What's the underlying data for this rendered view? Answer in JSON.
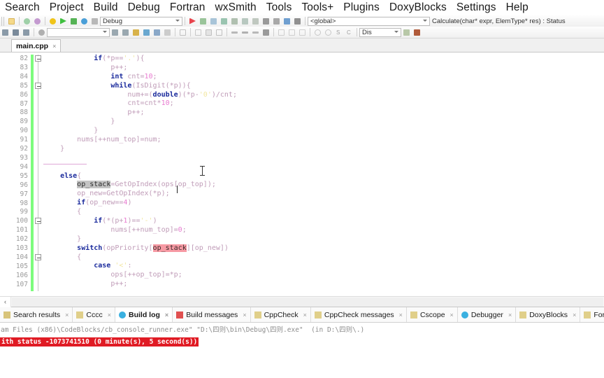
{
  "menubar": {
    "items": [
      {
        "label": "Search"
      },
      {
        "label": "Project"
      },
      {
        "label": "Build"
      },
      {
        "label": "Debug"
      },
      {
        "label": "Fortran"
      },
      {
        "label": "wxSmith"
      },
      {
        "label": "Tools"
      },
      {
        "label": "Tools+"
      },
      {
        "label": "Plugins"
      },
      {
        "label": "DoxyBlocks"
      },
      {
        "label": "Settings"
      },
      {
        "label": "Help"
      }
    ]
  },
  "toolbar": {
    "build_target": "Debug",
    "scope": "<global>",
    "function": "Calculate(char* expr, ElemType* res) : Status",
    "search_value": "",
    "dis_value": "Dis",
    "icons_row1": [
      "new-file-icon",
      "find-icon",
      "find-replace-icon",
      "build-icon",
      "run-icon",
      "build-and-run-icon",
      "rebuild-icon",
      "abort-icon"
    ],
    "icons_debug": [
      "debug-continue-icon",
      "debug-run-to-cursor-icon",
      "debug-next-line-icon",
      "debug-step-into-icon",
      "debug-step-out-icon",
      "debug-next-instruction-icon",
      "debug-step-into-instruction-icon",
      "debug-break-icon",
      "debug-stop-icon",
      "debug-info-icon",
      "debug-window-icon"
    ],
    "icons_row2": [
      "nav-back-icon",
      "nav-home-icon",
      "nav-forward-icon",
      "clear-icon",
      "goto-prev-icon",
      "goto-next-icon",
      "bookmark-icon",
      "translate-icon",
      "compare-icon",
      "more-icon"
    ]
  },
  "file_tabs": [
    {
      "label": "main.cpp",
      "close": "×",
      "active": true
    }
  ],
  "editor": {
    "first_line": 82,
    "code_lines": [
      {
        "n": 82,
        "html": "            <k>if</k>(*p==<s>'.'</s>){"
      },
      {
        "n": 83,
        "html": "                p++;"
      },
      {
        "n": 84,
        "html": "                <k>int</k> cnt=<num>10</num>;"
      },
      {
        "n": 85,
        "html": "                <k>while</k>(IsDigit(*p)){"
      },
      {
        "n": 86,
        "html": "                    num+=(<k>double</k>)(*p-<s>'0'</s>)/cnt;"
      },
      {
        "n": 87,
        "html": "                    cnt=cnt*<num>10</num>;"
      },
      {
        "n": 88,
        "html": "                    p++;"
      },
      {
        "n": 89,
        "html": "                }"
      },
      {
        "n": 90,
        "html": "            }"
      },
      {
        "n": 91,
        "html": "        nums[++num_top]=num;"
      },
      {
        "n": 92,
        "html": "    }"
      },
      {
        "n": 93,
        "html": ""
      },
      {
        "n": 94,
        "html": "<rule></rule>"
      },
      {
        "n": 95,
        "html": "    <k>else</k>{"
      },
      {
        "n": 96,
        "html": "        <selg>op_stack</selg>=GetOpIndex(ops[op_top]);"
      },
      {
        "n": 97,
        "html": "        op_new=GetOpIndex(*p);"
      },
      {
        "n": 98,
        "html": "        <k>if</k>(op_new==<num>4</num>)"
      },
      {
        "n": 99,
        "html": "        {"
      },
      {
        "n": 100,
        "html": "            <k>if</k>(*(p+<num>1</num>)==<s>'-'</s>)"
      },
      {
        "n": 101,
        "html": "                nums[++num_top]=<num>0</num>;"
      },
      {
        "n": 102,
        "html": "        }"
      },
      {
        "n": 103,
        "html": "        <k>switch</k>(opPriority[<selp>op_stack</selp>][op_new])"
      },
      {
        "n": 104,
        "html": "        {"
      },
      {
        "n": 105,
        "html": "            <k>case</k> <s>'<'</s>:"
      },
      {
        "n": 106,
        "html": "                ops[++op_top]=*p;"
      },
      {
        "n": 107,
        "html": "                p++;"
      }
    ],
    "selected_token": "op_stack",
    "highlight_colors": {
      "selection_gray": "#c4c4c4",
      "occurrence_pink": "#f79aa4",
      "changed_line_green": "#7dfc7d",
      "keyword": "#1a2a9c",
      "number": "#e87ad0",
      "string": "#f2e6a0"
    },
    "scroll_left_label": "‹"
  },
  "log_tabs": [
    {
      "label": "Search results",
      "icon": "search-results-icon",
      "close": "×",
      "active": false
    },
    {
      "label": "Cccc",
      "icon": "document-icon",
      "close": "×",
      "active": false
    },
    {
      "label": "Build log",
      "icon": "build-log-icon",
      "close": "×",
      "active": true
    },
    {
      "label": "Build messages",
      "icon": "build-messages-icon",
      "close": "×",
      "active": false
    },
    {
      "label": "CppCheck",
      "icon": "document-icon",
      "close": "×",
      "active": false
    },
    {
      "label": "CppCheck messages",
      "icon": "document-icon",
      "close": "×",
      "active": false
    },
    {
      "label": "Cscope",
      "icon": "document-icon",
      "close": "×",
      "active": false
    },
    {
      "label": "Debugger",
      "icon": "debugger-icon",
      "close": "×",
      "active": false
    },
    {
      "label": "DoxyBlocks",
      "icon": "document-icon",
      "close": "×",
      "active": false
    },
    {
      "label": "Fortran info",
      "icon": "document-icon",
      "close": "",
      "active": false
    }
  ],
  "build_log": {
    "line1": "am Files (x86)\\CodeBlocks/cb_console_runner.exe\" \"D:\\四则\\bin\\Debug\\四则.exe\"  (in D:\\四则\\.)",
    "line2": "ith status -1073741510 (0 minute(s), 5 second(s))"
  }
}
